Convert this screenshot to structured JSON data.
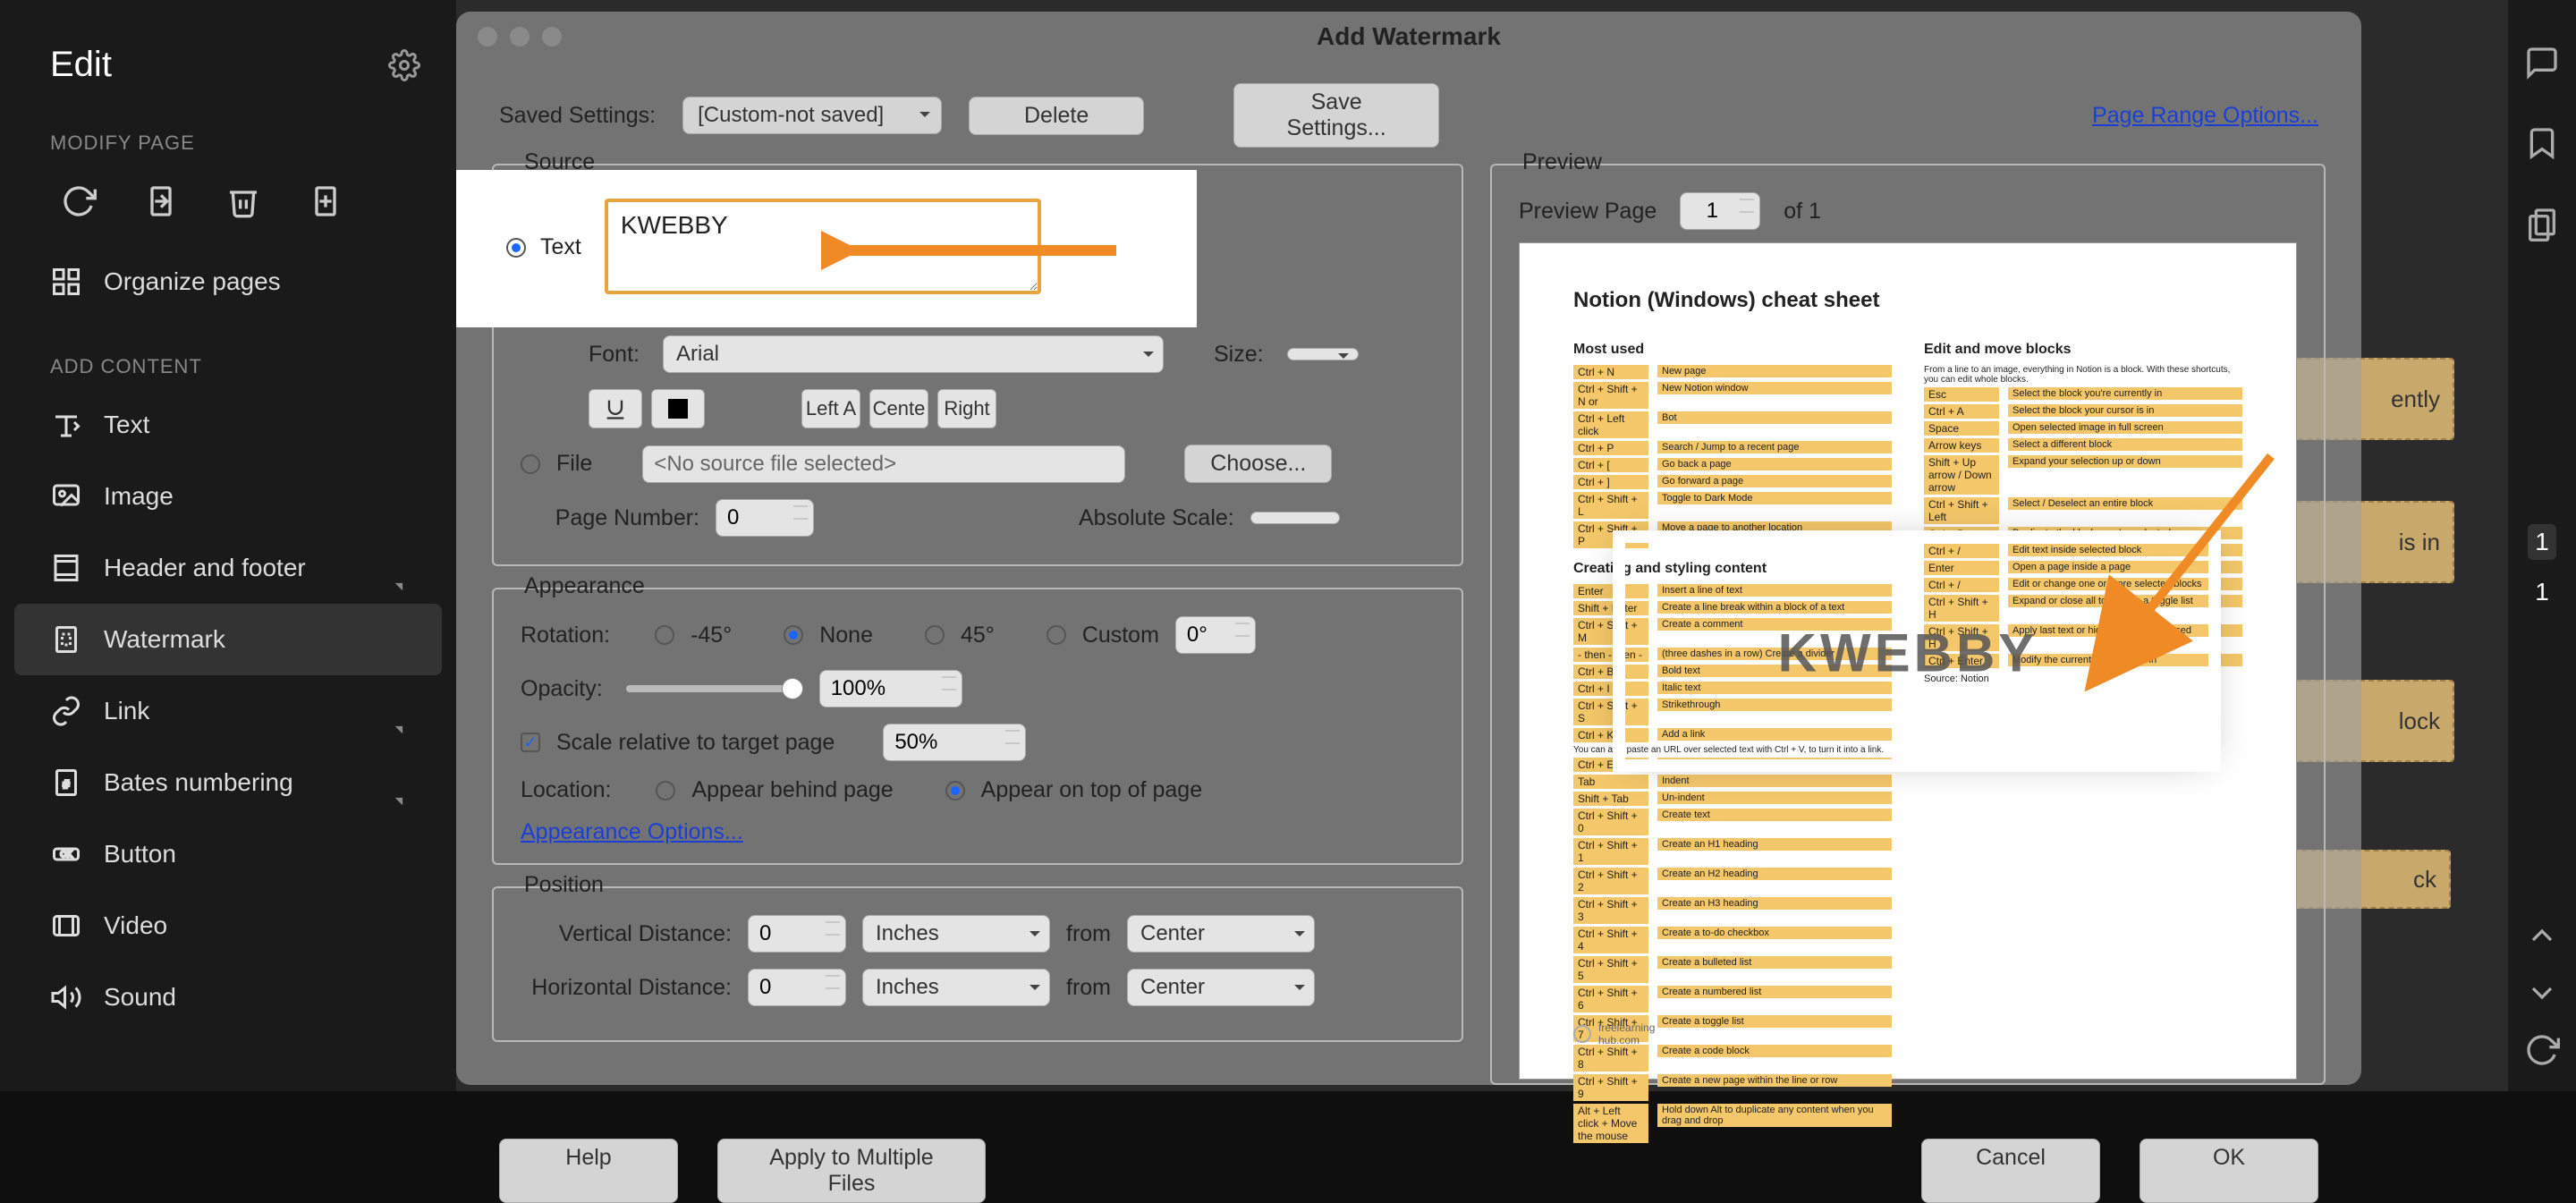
{
  "sidebar": {
    "title": "Edit",
    "sections": {
      "modify": "MODIFY PAGE",
      "add": "ADD CONTENT"
    },
    "items": {
      "organize": "Organize pages",
      "text": "Text",
      "image": "Image",
      "header_footer": "Header and footer",
      "watermark": "Watermark",
      "link": "Link",
      "bates": "Bates numbering",
      "button": "Button",
      "video": "Video",
      "sound": "Sound"
    }
  },
  "modal": {
    "title": "Add Watermark",
    "saved_settings_label": "Saved Settings:",
    "saved_settings_value": "[Custom-not saved]",
    "delete": "Delete",
    "save_settings": "Save Settings...",
    "page_range_options": "Page Range Options...",
    "source": {
      "legend": "Source",
      "text_radio": "Text",
      "text_value": "KWEBBY",
      "font_label": "Font:",
      "font_value": "Arial",
      "size_label": "Size:",
      "align": {
        "left": "Left A",
        "center": "Cente",
        "right": "Right"
      },
      "file_radio": "File",
      "file_value": "<No source file selected>",
      "choose": "Choose...",
      "page_number_label": "Page Number:",
      "page_number_value": "0",
      "absolute_scale_label": "Absolute Scale:"
    },
    "appearance": {
      "legend": "Appearance",
      "rotation_label": "Rotation:",
      "rot_options": {
        "neg45": "-45°",
        "none": "None",
        "pos45": "45°",
        "custom": "Custom"
      },
      "custom_value": "0°",
      "opacity_label": "Opacity:",
      "opacity_value": "100%",
      "scale_relative": "Scale relative to target page",
      "scale_value": "50%",
      "location_label": "Location:",
      "behind": "Appear behind page",
      "ontop": "Appear on top of page",
      "options_link": "Appearance Options..."
    },
    "position": {
      "legend": "Position",
      "vdist_label": "Vertical Distance:",
      "hdist_label": "Horizontal Distance:",
      "value": "0",
      "units": "Inches",
      "from": "from",
      "origin": "Center"
    },
    "preview": {
      "legend": "Preview",
      "page_label": "Preview Page",
      "page_value": "1",
      "of_label": "of 1",
      "watermark_text": "KWEBBY",
      "doc_title": "Notion (Windows) cheat sheet",
      "col1_h1": "Most used",
      "col1_h2": "Creating and styling content",
      "col2_h1": "Edit and move blocks"
    },
    "footer": {
      "help": "Help",
      "apply_multiple": "Apply to Multiple Files",
      "cancel": "Cancel",
      "ok": "OK"
    }
  },
  "right": {
    "page_current": "1",
    "page_total": "1"
  },
  "peek": {
    "a": "ently",
    "b": "is in",
    "c": "lock",
    "d": "ck"
  }
}
